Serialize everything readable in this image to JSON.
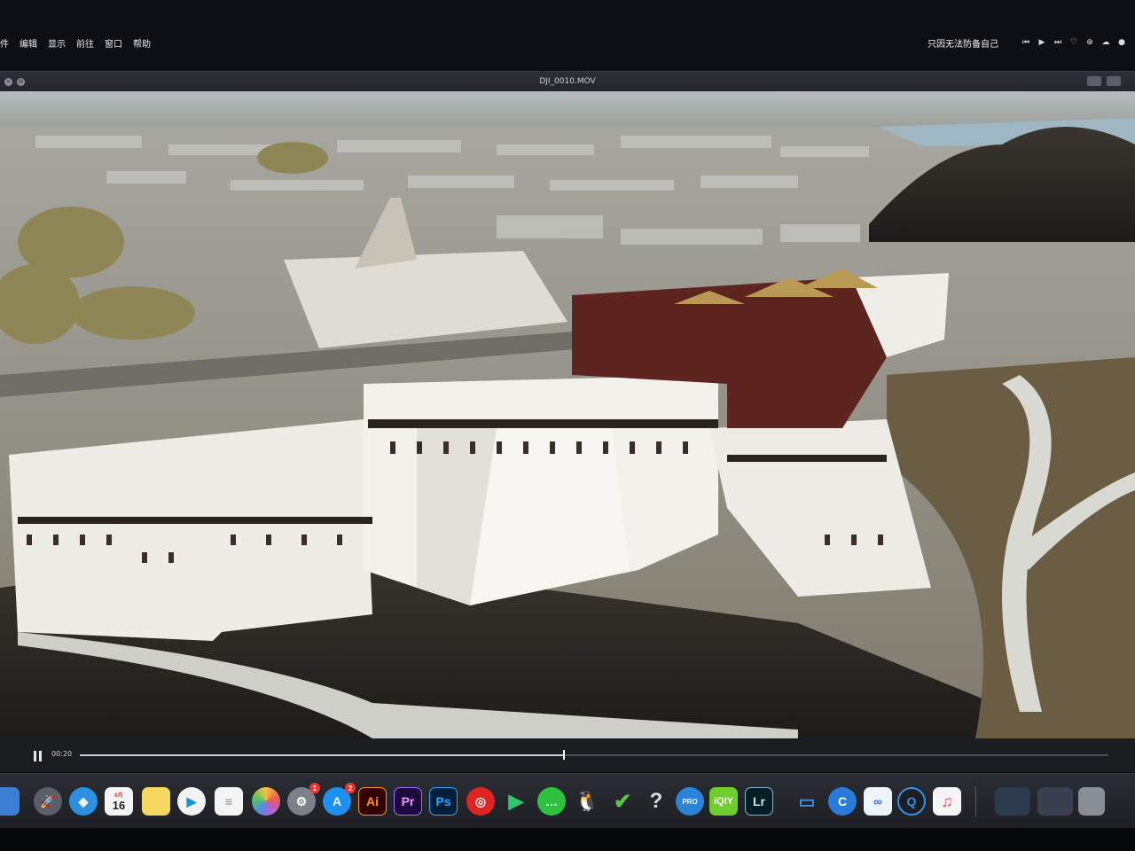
{
  "menubar": {
    "items": [
      "件",
      "编辑",
      "显示",
      "前往",
      "窗口",
      "帮助"
    ],
    "now_playing": "只因无法防备自己",
    "tray_icons": [
      "previous-track-icon",
      "play-icon",
      "next-track-icon",
      "heart-icon",
      "close-icon",
      "cloud-icon",
      "lock-icon"
    ]
  },
  "window": {
    "title": "DJI_0010.MOV",
    "controls": [
      "close-icon",
      "minimize-icon"
    ]
  },
  "player": {
    "time": "00:20",
    "progress": 0.47
  },
  "dock": {
    "calendar_month": "6月",
    "calendar_day": "16",
    "system_prefs_badge": "1",
    "app_store_badge": "2",
    "apps": [
      {
        "name": "finder",
        "label": ""
      },
      {
        "name": "launchpad",
        "label": ""
      },
      {
        "name": "safari",
        "label": ""
      },
      {
        "name": "calendar",
        "label": ""
      },
      {
        "name": "notes",
        "label": ""
      },
      {
        "name": "video-app",
        "label": ""
      },
      {
        "name": "reminders",
        "label": ""
      },
      {
        "name": "photos",
        "label": ""
      },
      {
        "name": "system-preferences",
        "label": ""
      },
      {
        "name": "app-store",
        "label": ""
      },
      {
        "name": "illustrator",
        "label": "Ai"
      },
      {
        "name": "premiere-pro",
        "label": "Pr"
      },
      {
        "name": "photoshop",
        "label": "Ps"
      },
      {
        "name": "netease-music",
        "label": ""
      },
      {
        "name": "tencent-video",
        "label": ""
      },
      {
        "name": "wechat",
        "label": ""
      },
      {
        "name": "qq",
        "label": ""
      },
      {
        "name": "checkmark-app",
        "label": ""
      },
      {
        "name": "help",
        "label": "?"
      },
      {
        "name": "pro-player",
        "label": "PRO"
      },
      {
        "name": "iqiyi",
        "label": "iQIY"
      },
      {
        "name": "lightroom",
        "label": "Lr"
      },
      {
        "name": "keynote",
        "label": ""
      },
      {
        "name": "chrome-pro",
        "label": ""
      },
      {
        "name": "baidu-netdisk",
        "label": ""
      },
      {
        "name": "quicktime",
        "label": ""
      },
      {
        "name": "music",
        "label": ""
      }
    ]
  }
}
